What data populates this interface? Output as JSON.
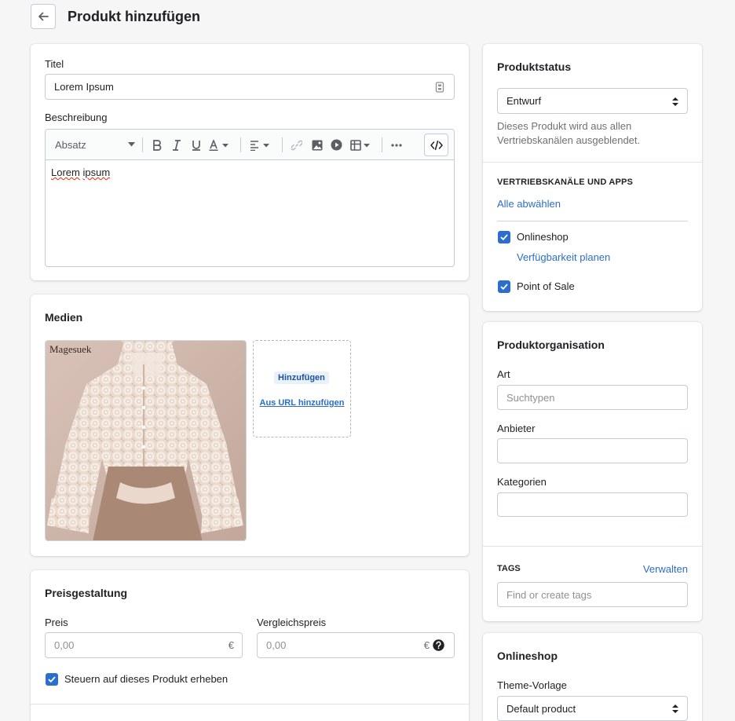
{
  "page": {
    "title": "Produkt hinzufügen"
  },
  "general": {
    "title_label": "Titel",
    "title_value": "Lorem Ipsum",
    "description_label": "Beschreibung",
    "format_label": "Absatz",
    "description_text_1": "Lorem",
    "description_text_2": "ipsum"
  },
  "media": {
    "title": "Medien",
    "image_brand": "Magesuek",
    "add_button": "Hinzufügen",
    "add_url_link": "Aus URL hinzufügen"
  },
  "pricing": {
    "title": "Preisgestaltung",
    "price_label": "Preis",
    "price_value": "0,00",
    "compare_label": "Vergleichspreis",
    "compare_value": "0,00",
    "currency": "€",
    "tax_label": "Steuern auf dieses Produkt erheben",
    "tax_checked": true
  },
  "status": {
    "title": "Produktstatus",
    "selected": "Entwurf",
    "help": "Dieses Produkt wird aus allen Vertriebskanälen ausgeblendet.",
    "channels_heading": "VERTRIEBSKANÄLE UND APPS",
    "deselect_all": "Alle abwählen",
    "channel_1": "Onlineshop",
    "channel_1_link": "Verfügbarkeit planen",
    "channel_2": "Point of Sale"
  },
  "organization": {
    "title": "Produktorganisation",
    "type_label": "Art",
    "type_placeholder": "Suchtypen",
    "vendor_label": "Anbieter",
    "collections_label": "Kategorien",
    "tags_heading": "TAGS",
    "manage_link": "Verwalten",
    "tags_placeholder": "Find or create tags"
  },
  "onlineshop": {
    "title": "Onlineshop",
    "template_label": "Theme-Vorlage",
    "template_value": "Default product"
  },
  "colors": {
    "accent": "#2c6ecb",
    "background": "#f6f6f7"
  }
}
